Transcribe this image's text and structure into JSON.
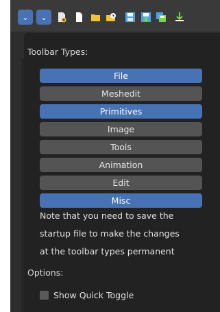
{
  "popup": {
    "toolbar_types_label": "Toolbar Types:",
    "types": [
      {
        "label": "File",
        "active": true
      },
      {
        "label": "Meshedit",
        "active": false
      },
      {
        "label": "Primitives",
        "active": true
      },
      {
        "label": "Image",
        "active": false
      },
      {
        "label": "Tools",
        "active": false
      },
      {
        "label": "Animation",
        "active": false
      },
      {
        "label": "Edit",
        "active": false
      },
      {
        "label": "Misc",
        "active": true
      }
    ],
    "note_lines": [
      "Note that you need to save the",
      "startup file to make the changes",
      "at the toolbar types permanent"
    ],
    "options_label": "Options:",
    "show_quick_toggle": {
      "label": "Show Quick Toggle",
      "checked": false
    }
  },
  "toolbar": {
    "icons": [
      "chevron-down-icon",
      "chevron-down-icon",
      "new-file-icon",
      "file-icon",
      "open-folder-icon",
      "recent-icon",
      "save-icon",
      "save-as-icon",
      "save-copy-icon",
      "import-icon"
    ]
  },
  "colors": {
    "accent": "#4772b3",
    "button": "#545454",
    "popup_bg": "#222222"
  }
}
